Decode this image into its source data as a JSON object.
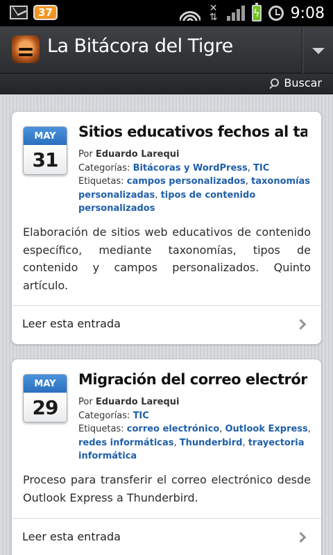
{
  "status_bar": {
    "notification_count": "37",
    "time": "9:08",
    "icons": [
      "gmail-icon",
      "wifi-icon",
      "data-arrows-icon",
      "signal-icon",
      "battery-charging-icon",
      "alarm-icon"
    ]
  },
  "app_bar": {
    "title": "La Bitácora del Tigre",
    "logo_icon": "tiger-logo-icon",
    "menu_icon": "dropdown-triangle-icon"
  },
  "search": {
    "label": "Buscar",
    "icon": "search-icon"
  },
  "colors": {
    "link": "#1f5fa8",
    "date_header": "#2a6fbe",
    "app_bar": "#3f4245"
  },
  "posts": [
    {
      "month": "MAY",
      "day": "31",
      "title": "Sitios educativos fechos al taxo...",
      "by_label": "Por",
      "author": "Eduardo Larequi",
      "categories_label": "Categorías:",
      "categories": [
        "Bitácoras y WordPress",
        "TIC"
      ],
      "tags_label": "Etiquetas:",
      "tags": [
        "campos personalizados",
        "taxonomías personalizadas",
        "tipos de contenido personalizados"
      ],
      "excerpt": "Elaboración de sitios web educativos de contenido específico, mediante taxonomías, tipos de contenido y campos personalizados. Quinto artículo.",
      "read_more": "Leer esta entrada"
    },
    {
      "month": "MAY",
      "day": "29",
      "title": "Migración del correo electrónic...",
      "by_label": "Por",
      "author": "Eduardo Larequi",
      "categories_label": "Categorías:",
      "categories": [
        "TIC"
      ],
      "tags_label": "Etiquetas:",
      "tags": [
        "correo electrónico",
        "Outlook Express",
        "redes informáticas",
        "Thunderbird",
        "trayectoria informática"
      ],
      "excerpt": "Proceso para transferir el correo electrónico desde Outlook Express a Thunderbird.",
      "read_more": "Leer esta entrada"
    }
  ]
}
